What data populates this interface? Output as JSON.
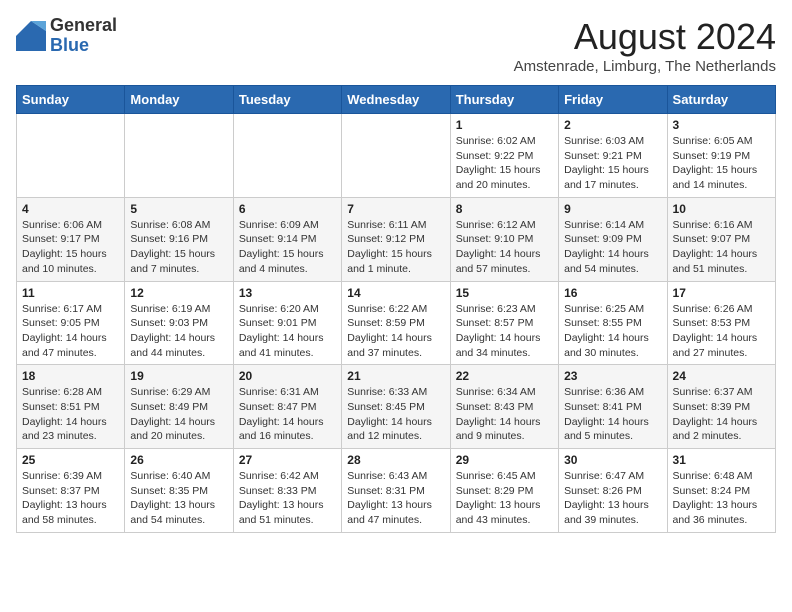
{
  "logo": {
    "general": "General",
    "blue": "Blue"
  },
  "title": "August 2024",
  "location": "Amstenrade, Limburg, The Netherlands",
  "weekdays": [
    "Sunday",
    "Monday",
    "Tuesday",
    "Wednesday",
    "Thursday",
    "Friday",
    "Saturday"
  ],
  "weeks": [
    [
      {
        "day": "",
        "info": ""
      },
      {
        "day": "",
        "info": ""
      },
      {
        "day": "",
        "info": ""
      },
      {
        "day": "",
        "info": ""
      },
      {
        "day": "1",
        "info": "Sunrise: 6:02 AM\nSunset: 9:22 PM\nDaylight: 15 hours\nand 20 minutes."
      },
      {
        "day": "2",
        "info": "Sunrise: 6:03 AM\nSunset: 9:21 PM\nDaylight: 15 hours\nand 17 minutes."
      },
      {
        "day": "3",
        "info": "Sunrise: 6:05 AM\nSunset: 9:19 PM\nDaylight: 15 hours\nand 14 minutes."
      }
    ],
    [
      {
        "day": "4",
        "info": "Sunrise: 6:06 AM\nSunset: 9:17 PM\nDaylight: 15 hours\nand 10 minutes."
      },
      {
        "day": "5",
        "info": "Sunrise: 6:08 AM\nSunset: 9:16 PM\nDaylight: 15 hours\nand 7 minutes."
      },
      {
        "day": "6",
        "info": "Sunrise: 6:09 AM\nSunset: 9:14 PM\nDaylight: 15 hours\nand 4 minutes."
      },
      {
        "day": "7",
        "info": "Sunrise: 6:11 AM\nSunset: 9:12 PM\nDaylight: 15 hours\nand 1 minute."
      },
      {
        "day": "8",
        "info": "Sunrise: 6:12 AM\nSunset: 9:10 PM\nDaylight: 14 hours\nand 57 minutes."
      },
      {
        "day": "9",
        "info": "Sunrise: 6:14 AM\nSunset: 9:09 PM\nDaylight: 14 hours\nand 54 minutes."
      },
      {
        "day": "10",
        "info": "Sunrise: 6:16 AM\nSunset: 9:07 PM\nDaylight: 14 hours\nand 51 minutes."
      }
    ],
    [
      {
        "day": "11",
        "info": "Sunrise: 6:17 AM\nSunset: 9:05 PM\nDaylight: 14 hours\nand 47 minutes."
      },
      {
        "day": "12",
        "info": "Sunrise: 6:19 AM\nSunset: 9:03 PM\nDaylight: 14 hours\nand 44 minutes."
      },
      {
        "day": "13",
        "info": "Sunrise: 6:20 AM\nSunset: 9:01 PM\nDaylight: 14 hours\nand 41 minutes."
      },
      {
        "day": "14",
        "info": "Sunrise: 6:22 AM\nSunset: 8:59 PM\nDaylight: 14 hours\nand 37 minutes."
      },
      {
        "day": "15",
        "info": "Sunrise: 6:23 AM\nSunset: 8:57 PM\nDaylight: 14 hours\nand 34 minutes."
      },
      {
        "day": "16",
        "info": "Sunrise: 6:25 AM\nSunset: 8:55 PM\nDaylight: 14 hours\nand 30 minutes."
      },
      {
        "day": "17",
        "info": "Sunrise: 6:26 AM\nSunset: 8:53 PM\nDaylight: 14 hours\nand 27 minutes."
      }
    ],
    [
      {
        "day": "18",
        "info": "Sunrise: 6:28 AM\nSunset: 8:51 PM\nDaylight: 14 hours\nand 23 minutes."
      },
      {
        "day": "19",
        "info": "Sunrise: 6:29 AM\nSunset: 8:49 PM\nDaylight: 14 hours\nand 20 minutes."
      },
      {
        "day": "20",
        "info": "Sunrise: 6:31 AM\nSunset: 8:47 PM\nDaylight: 14 hours\nand 16 minutes."
      },
      {
        "day": "21",
        "info": "Sunrise: 6:33 AM\nSunset: 8:45 PM\nDaylight: 14 hours\nand 12 minutes."
      },
      {
        "day": "22",
        "info": "Sunrise: 6:34 AM\nSunset: 8:43 PM\nDaylight: 14 hours\nand 9 minutes."
      },
      {
        "day": "23",
        "info": "Sunrise: 6:36 AM\nSunset: 8:41 PM\nDaylight: 14 hours\nand 5 minutes."
      },
      {
        "day": "24",
        "info": "Sunrise: 6:37 AM\nSunset: 8:39 PM\nDaylight: 14 hours\nand 2 minutes."
      }
    ],
    [
      {
        "day": "25",
        "info": "Sunrise: 6:39 AM\nSunset: 8:37 PM\nDaylight: 13 hours\nand 58 minutes."
      },
      {
        "day": "26",
        "info": "Sunrise: 6:40 AM\nSunset: 8:35 PM\nDaylight: 13 hours\nand 54 minutes."
      },
      {
        "day": "27",
        "info": "Sunrise: 6:42 AM\nSunset: 8:33 PM\nDaylight: 13 hours\nand 51 minutes."
      },
      {
        "day": "28",
        "info": "Sunrise: 6:43 AM\nSunset: 8:31 PM\nDaylight: 13 hours\nand 47 minutes."
      },
      {
        "day": "29",
        "info": "Sunrise: 6:45 AM\nSunset: 8:29 PM\nDaylight: 13 hours\nand 43 minutes."
      },
      {
        "day": "30",
        "info": "Sunrise: 6:47 AM\nSunset: 8:26 PM\nDaylight: 13 hours\nand 39 minutes."
      },
      {
        "day": "31",
        "info": "Sunrise: 6:48 AM\nSunset: 8:24 PM\nDaylight: 13 hours\nand 36 minutes."
      }
    ]
  ]
}
